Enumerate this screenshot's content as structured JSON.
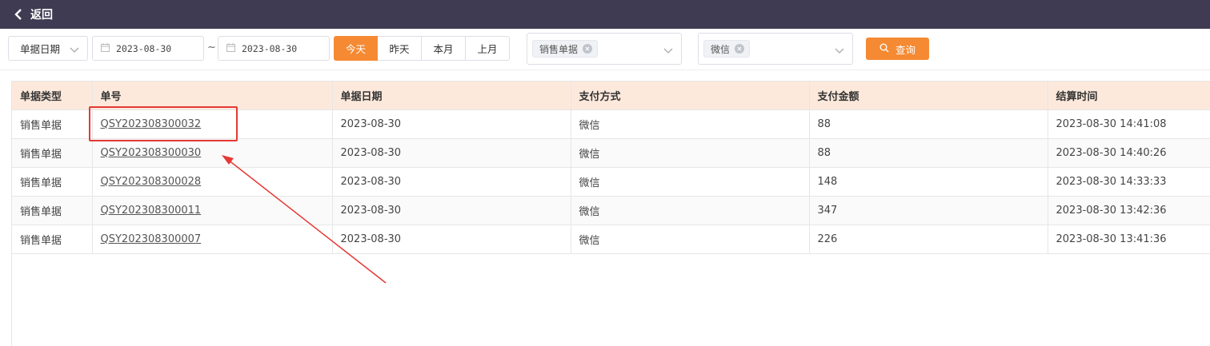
{
  "topbar": {
    "back_label": "返回"
  },
  "filters": {
    "date_type": "单据日期",
    "start_date": "2023-08-30",
    "end_date": "2023-08-30",
    "range_separator": "~",
    "quick": [
      "今天",
      "昨天",
      "本月",
      "上月"
    ],
    "doc_type_tag": "销售单据",
    "pay_tag": "微信",
    "query_label": "查询"
  },
  "table": {
    "columns": [
      "单据类型",
      "单号",
      "单据日期",
      "支付方式",
      "支付金额",
      "结算时间"
    ],
    "rows": [
      [
        "销售单据",
        "QSY202308300032",
        "2023-08-30",
        "微信",
        "88",
        "2023-08-30 14:41:08"
      ],
      [
        "销售单据",
        "QSY202308300030",
        "2023-08-30",
        "微信",
        "88",
        "2023-08-30 14:40:26"
      ],
      [
        "销售单据",
        "QSY202308300028",
        "2023-08-30",
        "微信",
        "148",
        "2023-08-30 14:33:33"
      ],
      [
        "销售单据",
        "QSY202308300011",
        "2023-08-30",
        "微信",
        "347",
        "2023-08-30 13:42:36"
      ],
      [
        "销售单据",
        "QSY202308300007",
        "2023-08-30",
        "微信",
        "226",
        "2023-08-30 13:41:36"
      ]
    ]
  },
  "colors": {
    "accent": "#f58a33",
    "topbar": "#3f3b52",
    "header_bg": "#fde9dc",
    "annotation": "#e53935"
  }
}
